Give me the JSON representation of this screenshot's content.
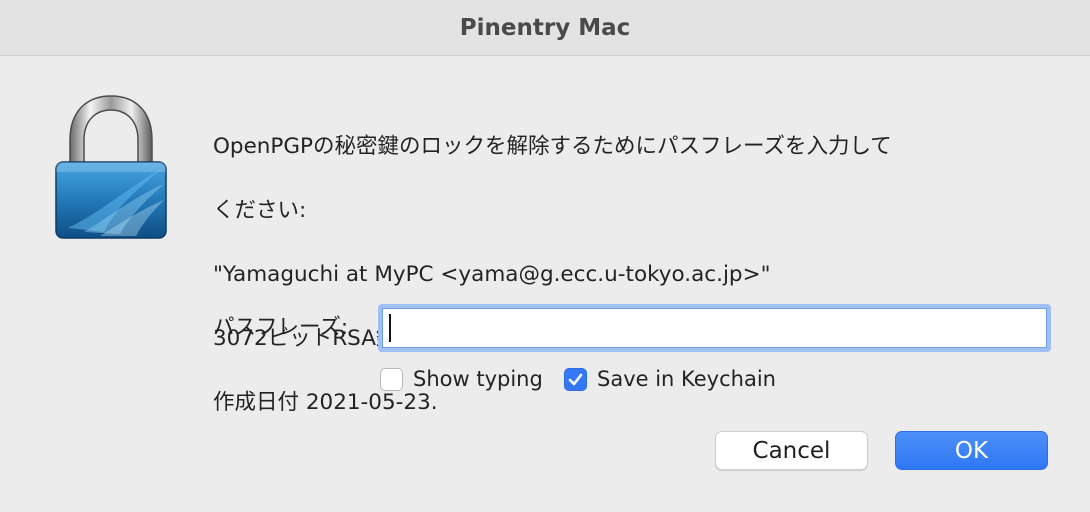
{
  "window": {
    "title": "Pinentry Mac"
  },
  "icon": "padlock-icon",
  "message": {
    "line1": "OpenPGPの秘密鍵のロックを解除するためにパスフレーズを入力して",
    "line2": "ください:",
    "line3": "\"Yamaguchi at MyPC <yama@g.ecc.u-tokyo.ac.jp>\"",
    "line4": "3072ビットRSA鍵, ID 1A48F112B29B25E1,",
    "line5": "作成日付 2021-05-23."
  },
  "passphrase": {
    "label": "パスフレーズ:",
    "value": ""
  },
  "options": {
    "show_typing": {
      "label": "Show typing",
      "checked": false
    },
    "save_in_keychain": {
      "label": "Save in Keychain",
      "checked": true
    }
  },
  "buttons": {
    "cancel": "Cancel",
    "ok": "OK"
  },
  "colors": {
    "accent": "#3478f6",
    "focus_ring": "#9ec0f4",
    "background": "#ececec"
  }
}
